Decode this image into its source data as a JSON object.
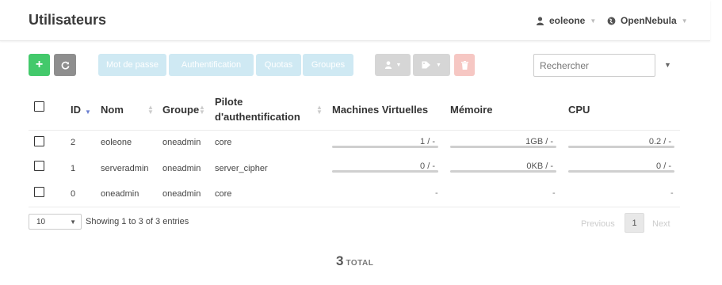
{
  "header": {
    "title": "Utilisateurs",
    "user": "eoleone",
    "zone": "OpenNebula"
  },
  "toolbar": {
    "create_label": "+",
    "password_label": "Mot de passe",
    "auth_label": "Authentification",
    "quotas_label": "Quotas",
    "groups_label": "Groupes"
  },
  "search": {
    "placeholder": "Rechercher"
  },
  "table": {
    "headers": {
      "id": "ID",
      "name": "Nom",
      "group": "Groupe",
      "auth_line1": "Pilote",
      "auth_line2": "d'authentification",
      "vms": "Machines Virtuelles",
      "memory": "Mémoire",
      "cpu": "CPU"
    },
    "rows": [
      {
        "id": "2",
        "name": "eoleone",
        "group": "oneadmin",
        "auth": "core",
        "vms": "1 / -",
        "memory": "1GB / -",
        "cpu": "0.2 / -"
      },
      {
        "id": "1",
        "name": "serveradmin",
        "group": "oneadmin",
        "auth": "server_cipher",
        "vms": "0 / -",
        "memory": "0KB / -",
        "cpu": "0 / -"
      },
      {
        "id": "0",
        "name": "oneadmin",
        "group": "oneadmin",
        "auth": "core",
        "vms": "-",
        "memory": "-",
        "cpu": "-"
      }
    ]
  },
  "footer": {
    "page_length": "10",
    "info": "Showing 1 to 3 of 3 entries",
    "previous": "Previous",
    "current_page": "1",
    "next": "Next"
  },
  "total": {
    "count": "3",
    "label": "TOTAL"
  },
  "colors": {
    "create": "#43c96b",
    "refresh": "#8e8e8e",
    "action_disabled": "#cfe9f3",
    "delete_disabled": "#f6c7c3"
  },
  "icons": [
    "user-icon",
    "globe-icon",
    "refresh-icon",
    "user-icon",
    "tag-icon",
    "trash-icon",
    "sort-icon"
  ]
}
